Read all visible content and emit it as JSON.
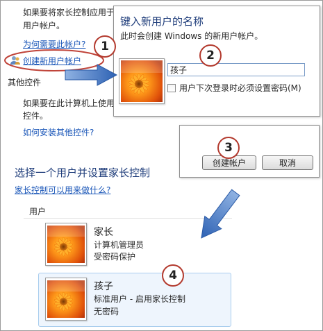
{
  "background_page": {
    "intro_line1": "如果要将家长控制应用于",
    "intro_line2": "用户帐户。",
    "why_need_link": "为何需要此帐户?",
    "create_account_link": "创建新用户帐户",
    "other_controls_heading": "其他控件",
    "other_controls_line1": "如果要在此计算机上使用",
    "other_controls_line2": "控件。",
    "how_install_link": "如何安装其他控件?",
    "select_user_heading": "选择一个用户并设置家长控制",
    "what_can_do_link": "家长控制可以用来做什么?",
    "users_label": "用户"
  },
  "new_user_dialog": {
    "title": "键入新用户的名称",
    "subtitle": "此时会创建 Windows 的新用户帐户。",
    "name_value": "孩子",
    "require_password_label": "用户下次登录时必须设置密码(M)",
    "require_password_checked": false
  },
  "button_panel": {
    "create_button": "创建帐户",
    "cancel_button": "取消"
  },
  "users": [
    {
      "name": "家长",
      "line1": "计算机管理员",
      "line2": "受密码保护"
    },
    {
      "name": "孩子",
      "line1": "标准用户 - 启用家长控制",
      "line2": "无密码"
    }
  ],
  "step_badges": [
    "1",
    "2",
    "3",
    "4"
  ],
  "colors": {
    "link": "#1a56b8",
    "badge_ring": "#b33a2e",
    "arrow_blue": "#3a72c0",
    "highlight_ellipse": "#c0443a",
    "selected_row_bg": "#eef5fd",
    "selected_row_border": "#a9cdee"
  },
  "icons": {
    "user_tile": "orange-flower-avatar",
    "user_shield": "user-account-icon",
    "step_arrow": "blue-arrow"
  }
}
